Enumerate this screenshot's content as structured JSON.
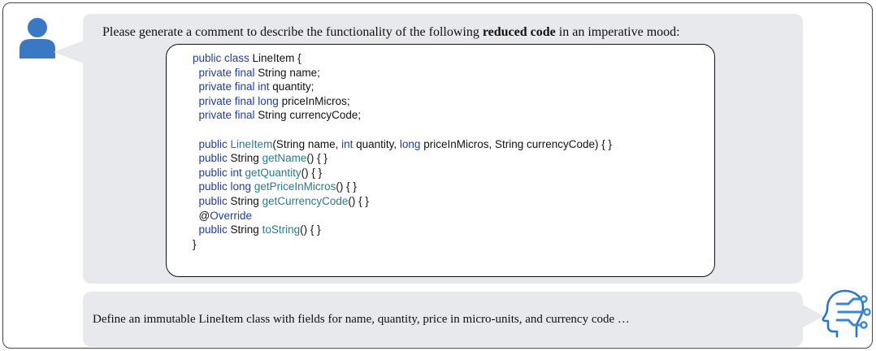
{
  "prompt": {
    "text_before": "Please generate a comment to describe the functionality of the following ",
    "text_bold": "reduced code",
    "text_after": " in an imperative mood:"
  },
  "code_lines": [
    [
      [
        "kw",
        "public class "
      ],
      [
        "plain",
        "LineItem {"
      ]
    ],
    [
      [
        "kw",
        "  private final "
      ],
      [
        "plain",
        "String name;"
      ]
    ],
    [
      [
        "kw",
        "  private final int "
      ],
      [
        "plain",
        "quantity;"
      ]
    ],
    [
      [
        "kw",
        "  private final long "
      ],
      [
        "plain",
        "priceInMicros;"
      ]
    ],
    [
      [
        "kw",
        "  private final "
      ],
      [
        "plain",
        "String currencyCode;"
      ]
    ],
    [],
    [
      [
        "kw",
        "  public "
      ],
      [
        "fn",
        "LineItem"
      ],
      [
        "plain",
        "(String name, "
      ],
      [
        "kw",
        "int "
      ],
      [
        "plain",
        "quantity, "
      ],
      [
        "kw",
        "long "
      ],
      [
        "plain",
        "priceInMicros, String currencyCode) { }"
      ]
    ],
    [
      [
        "kw",
        "  public "
      ],
      [
        "plain",
        "String "
      ],
      [
        "fn",
        "getName"
      ],
      [
        "plain",
        "() { }"
      ]
    ],
    [
      [
        "kw",
        "  public int "
      ],
      [
        "fn",
        "getQuantity"
      ],
      [
        "plain",
        "() { }"
      ]
    ],
    [
      [
        "kw",
        "  public long "
      ],
      [
        "fn",
        "getPriceInMicros"
      ],
      [
        "plain",
        "() { }"
      ]
    ],
    [
      [
        "kw",
        "  public "
      ],
      [
        "plain",
        "String "
      ],
      [
        "fn",
        "getCurrencyCode"
      ],
      [
        "plain",
        "() { }"
      ]
    ],
    [
      [
        "plain",
        "  @"
      ],
      [
        "kw",
        "Override"
      ]
    ],
    [
      [
        "kw",
        "  public "
      ],
      [
        "plain",
        "String "
      ],
      [
        "fn",
        "toString"
      ],
      [
        "plain",
        "() { }"
      ]
    ],
    [
      [
        "plain",
        "}"
      ]
    ]
  ],
  "reply": {
    "text": "Define an immutable LineItem class with fields for name, quantity, price in micro-units, and currency code …"
  },
  "colors": {
    "bubble": "#e8e9ec",
    "user_avatar": "#3b78c4",
    "keyword": "#1f3d9e",
    "method": "#2a7a8a"
  },
  "icons": {
    "user": "user-icon",
    "assistant": "ai-head-icon"
  }
}
